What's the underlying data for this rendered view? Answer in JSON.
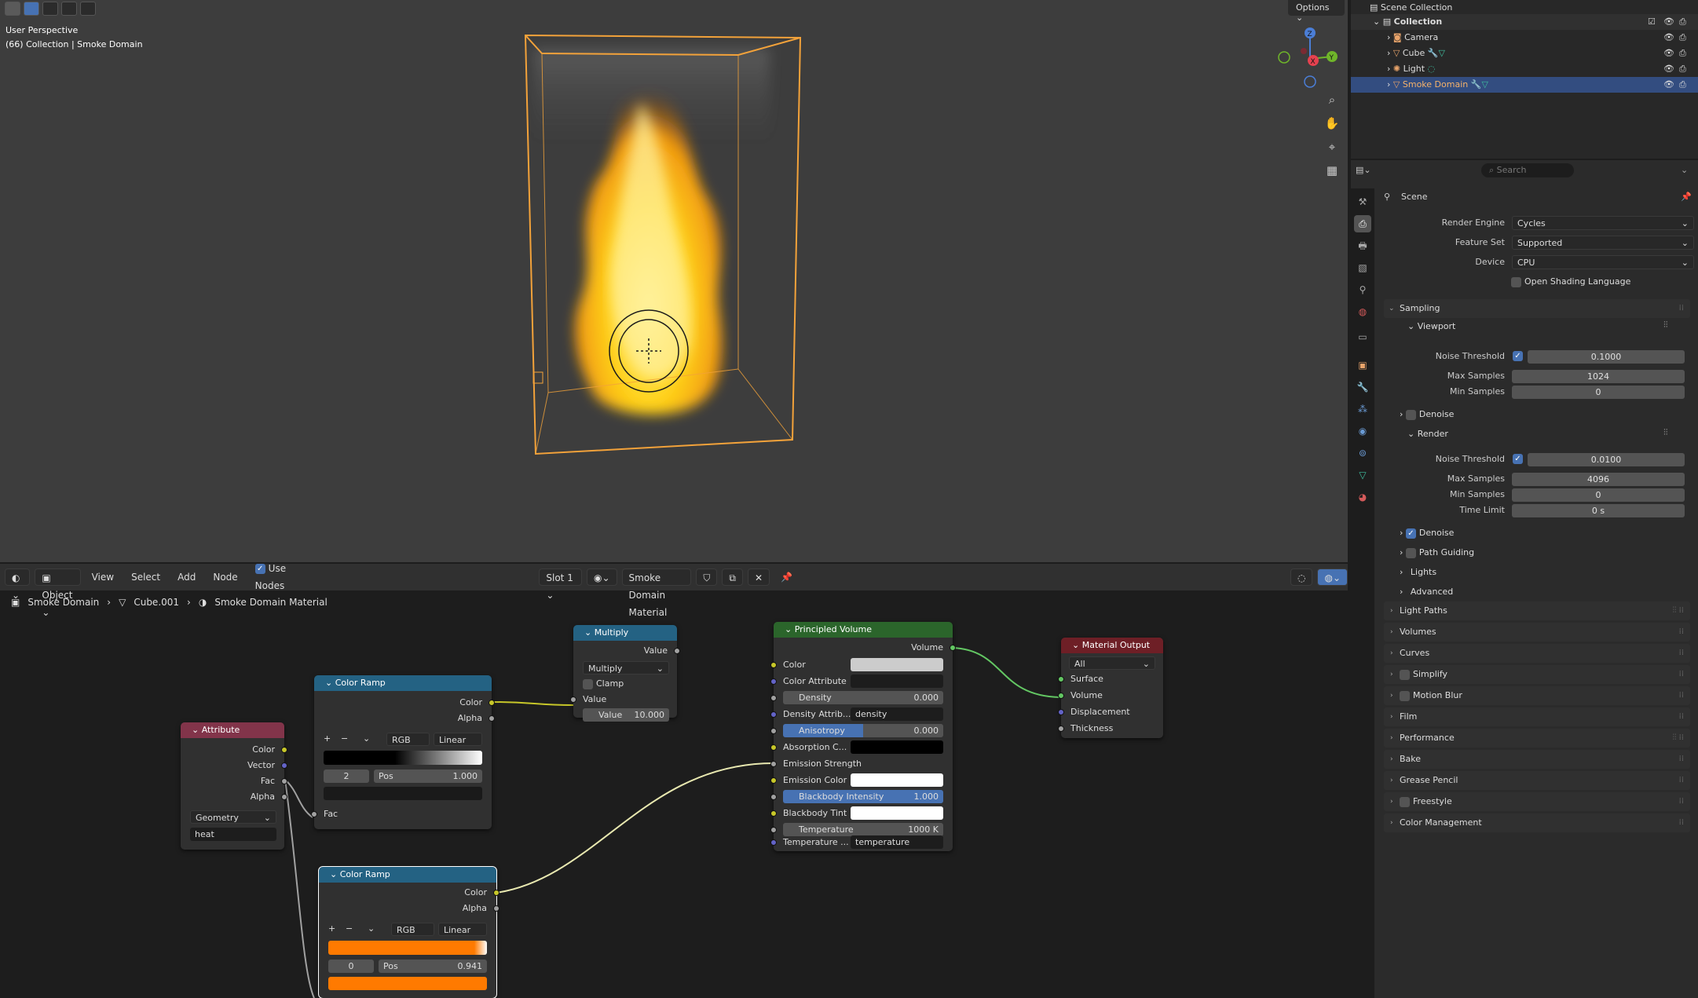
{
  "viewport": {
    "info_line1": "User Perspective",
    "info_line2": "(66) Collection | Smoke Domain",
    "options_label": "Options",
    "gizmo_x": "X",
    "gizmo_y": "Y",
    "gizmo_z": "Z"
  },
  "node_header": {
    "editor_type": "Object",
    "menus": [
      "View",
      "Select",
      "Add",
      "Node"
    ],
    "use_nodes_label": "Use Nodes",
    "slot": "Slot 1",
    "material_name": "Smoke Domain Material"
  },
  "breadcrumb": {
    "object": "Smoke Domain",
    "mesh": "Cube.001",
    "material": "Smoke Domain Material"
  },
  "nodes": {
    "attribute": {
      "title": "Attribute",
      "outputs": [
        "Color",
        "Vector",
        "Fac",
        "Alpha"
      ],
      "type": "Geometry",
      "name": "heat",
      "header_color": "#82344a"
    },
    "ramp1": {
      "title": "Color Ramp",
      "out_color": "Color",
      "out_alpha": "Alpha",
      "mode": "RGB",
      "interp": "Linear",
      "index": "2",
      "pos_label": "Pos",
      "pos_value": "1.000",
      "input": "Fac",
      "header_color": "#246283"
    },
    "multiply": {
      "title": "Multiply",
      "output": "Value",
      "operation": "Multiply",
      "clamp": "Clamp",
      "input": "Value",
      "value_label": "Value",
      "value": "10.000",
      "header_color": "#246283"
    },
    "ramp2": {
      "title": "Color Ramp",
      "out_color": "Color",
      "out_alpha": "Alpha",
      "mode": "RGB",
      "interp": "Linear",
      "index": "0",
      "pos_label": "Pos",
      "pos_value": "0.941",
      "header_color": "#246283"
    },
    "volume": {
      "title": "Principled Volume",
      "output": "Volume",
      "color": "Color",
      "color_attr": "Color Attribute",
      "density_label": "Density",
      "density": "0.000",
      "density_attr_label": "Density Attrib...",
      "density_attr": "density",
      "aniso_label": "Anisotropy",
      "aniso": "0.000",
      "abs_color": "Absorption C...",
      "em_strength": "Emission Strength",
      "em_color": "Emission Color",
      "bb_label": "Blackbody Intensity",
      "bb": "1.000",
      "bb_tint": "Blackbody Tint",
      "temp_label": "Temperature",
      "temp": "1000 K",
      "temp_attr_label": "Temperature ...",
      "temp_attr": "temperature",
      "header_color": "#2b652b"
    },
    "output": {
      "title": "Material Output",
      "target": "All",
      "inputs": [
        "Surface",
        "Volume",
        "Displacement",
        "Thickness"
      ],
      "header_color": "#6e1f26"
    }
  },
  "outliner": {
    "root": "Scene Collection",
    "collection": "Collection",
    "items": [
      "Camera",
      "Cube",
      "Light",
      "Smoke Domain"
    ]
  },
  "properties": {
    "search_placeholder": "Search",
    "context": "Scene",
    "render_engine_label": "Render Engine",
    "render_engine": "Cycles",
    "feature_set_label": "Feature Set",
    "feature_set": "Supported",
    "device_label": "Device",
    "device": "CPU",
    "osl": "Open Shading Language",
    "sampling": "Sampling",
    "viewport": "Viewport",
    "noise_threshold": "Noise Threshold",
    "vp_noise": "0.1000",
    "max_samples": "Max Samples",
    "vp_max": "1024",
    "min_samples": "Min Samples",
    "vp_min": "0",
    "denoise": "Denoise",
    "render": "Render",
    "r_noise": "0.0100",
    "r_max": "4096",
    "r_min": "0",
    "time_limit": "Time Limit",
    "r_time": "0 s",
    "path_guiding": "Path Guiding",
    "lights": "Lights",
    "advanced": "Advanced",
    "sections": [
      "Light Paths",
      "Volumes",
      "Curves",
      "Simplify",
      "Motion Blur",
      "Film",
      "Performance",
      "Bake",
      "Grease Pencil",
      "Freestyle",
      "Color Management"
    ]
  }
}
